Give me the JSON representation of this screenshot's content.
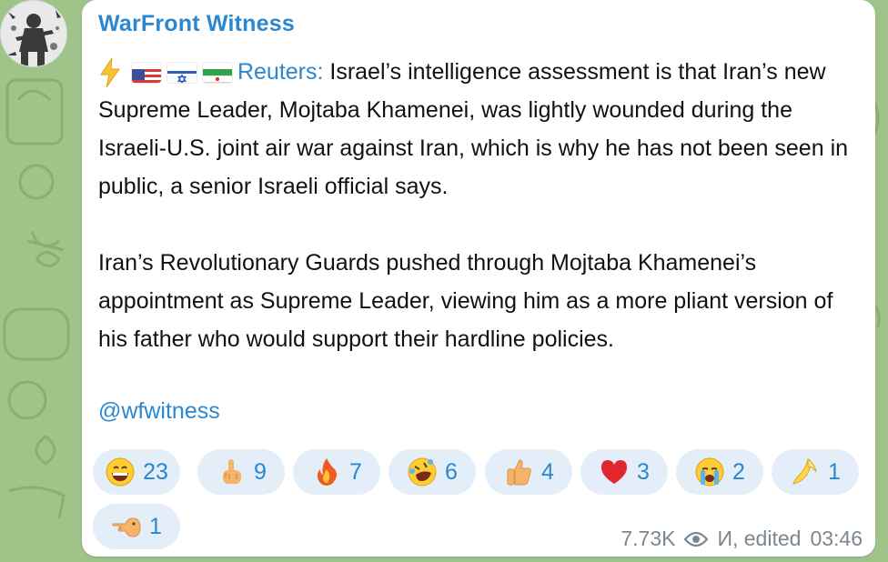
{
  "channel": {
    "name": "WarFront Witness"
  },
  "message": {
    "source": "Reuters:",
    "paragraph1_text": " Israel’s intelligence assessment is that Iran’s new Supreme Leader, Mojtaba Khamenei, was lightly wounded during the Israeli-U.S. joint air war against Iran, which is why he has not been seen in public, a senior Israeli official says.",
    "paragraph2": "Iran’s Revolutionary Guards pushed through Mojtaba Khamenei’s appointment as Supreme Leader, viewing him as a more pliant version of his father who would support their hardline policies.",
    "handle": "@wfwitness",
    "flags": [
      "us-flag-icon",
      "israel-flag-icon",
      "iran-flag-icon"
    ],
    "lead_icon": "lightning-icon"
  },
  "reactions": [
    {
      "icon": "grinning-face-icon",
      "count": "23"
    },
    {
      "icon": "middle-finger-icon",
      "count": "9"
    },
    {
      "icon": "fire-icon",
      "count": "7"
    },
    {
      "icon": "rolling-laughing-icon",
      "count": "6"
    },
    {
      "icon": "thumbs-up-icon",
      "count": "4"
    },
    {
      "icon": "red-heart-icon",
      "count": "3"
    },
    {
      "icon": "crying-face-icon",
      "count": "2"
    },
    {
      "icon": "banana-icon",
      "count": "1"
    },
    {
      "icon": "pointing-hand-icon",
      "count": "1"
    }
  ],
  "meta": {
    "views": "7.73K",
    "author_edited": "И, edited",
    "time": "03:46"
  },
  "colors": {
    "accent": "#2a87d0",
    "reaction_bg": "#e3eef8",
    "wallpaper": "#9fc389"
  }
}
